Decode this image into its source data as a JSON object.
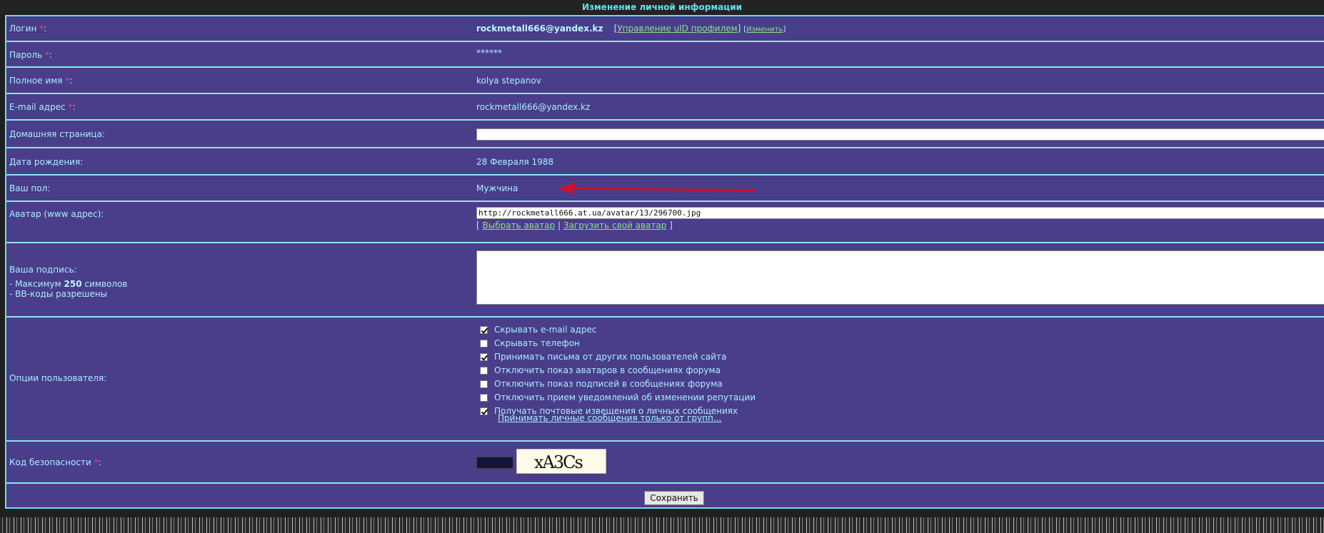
{
  "header": {
    "title": "Изменение личной информации"
  },
  "form": {
    "login": {
      "label": "Логин",
      "required_mark": "*",
      "value": "rockmetall666@yandex.kz",
      "manage_link": "Управление uID профилем",
      "change_link": "Изменить"
    },
    "password": {
      "label": "Пароль",
      "required_mark": "*",
      "value": "******"
    },
    "fullname": {
      "label": "Полное имя",
      "required_mark": "*",
      "value": "kolya stepanov"
    },
    "email": {
      "label": "E-mail адрес",
      "required_mark": "*",
      "value": "rockmetall666@yandex.kz"
    },
    "homepage": {
      "label": "Домашняя страница:",
      "value": ""
    },
    "birthday": {
      "label": "Дата рождения:",
      "value": "28 Февраля 1988"
    },
    "gender": {
      "label": "Ваш пол:",
      "value": "Мужчина"
    },
    "avatar": {
      "label": "Аватар (www адрес):",
      "value": "http://rockmetall666.at.ua/avatar/13/296700.jpg",
      "choose_link": "Выбрать аватар",
      "upload_link": "Загрузить свой аватар"
    },
    "signature": {
      "label": "Ваша подпись:",
      "limit_prefix": "- Максимум",
      "limit_value": "250",
      "limit_suffix": "символов",
      "bbcode_note": "- BB-коды разрешены",
      "value": ""
    },
    "options": {
      "label": "Опции пользователя:",
      "items": [
        {
          "label": "Скрывать e-mail адрес",
          "checked": true
        },
        {
          "label": "Скрывать телефон",
          "checked": false
        },
        {
          "label": "Принимать письма от других пользователей сайта",
          "checked": true
        },
        {
          "label": "Отключить показ аватаров в сообщениях форума",
          "checked": false
        },
        {
          "label": "Отключить показ подписей в сообщениях форума",
          "checked": false
        },
        {
          "label": "Отключить прием уведомлений об изменении репутации",
          "checked": false
        },
        {
          "label": "Получать почтовые извещения о личных сообщениях",
          "checked": true
        }
      ],
      "groups_link": "Принимать личные сообщения только от групп..."
    },
    "captcha": {
      "label": "Код безопасности",
      "required_mark": "*",
      "image_text": "xA3Cs"
    },
    "save_label": "Сохранить"
  },
  "colors": {
    "panel": "#4a3d8a",
    "text": "#a7f0ff",
    "link": "#8be08c",
    "required": "#ff3e6a",
    "arrow": "#d0112b"
  }
}
